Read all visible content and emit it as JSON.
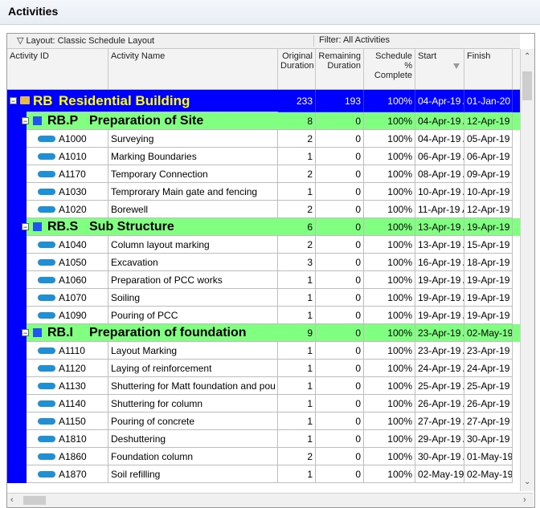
{
  "panel": {
    "title": "Activities"
  },
  "toolbar": {
    "layout_label": "Layout: Classic Schedule Layout",
    "filter_label": "Filter: All Activities"
  },
  "columns": [
    {
      "key": "id",
      "label": "Activity ID"
    },
    {
      "key": "name",
      "label": "Activity Name"
    },
    {
      "key": "orig",
      "label": "Original Duration"
    },
    {
      "key": "rem",
      "label": "Remaining Duration"
    },
    {
      "key": "pct",
      "label": "Schedule % Complete"
    },
    {
      "key": "start",
      "label": "Start"
    },
    {
      "key": "finish",
      "label": "Finish"
    }
  ],
  "colors": {
    "project_bg": "#0000ff",
    "project_text": "#ffff00",
    "wbs_bg": "#80ff80",
    "activity_bar": "#1f8fd6",
    "folder_icon": "#e7b94a",
    "wbs_icon": "#2255ee"
  },
  "rows": [
    {
      "type": "project",
      "id": "RB",
      "name": "Residential Building",
      "orig": "233",
      "rem": "193",
      "pct": "100%",
      "start": "04-Apr-19 A",
      "finish": "01-Jan-20"
    },
    {
      "type": "wbs",
      "id": "RB.P",
      "name": "Preparation of Site",
      "orig": "8",
      "rem": "0",
      "pct": "100%",
      "start": "04-Apr-19 A",
      "finish": "12-Apr-19 A"
    },
    {
      "type": "activity",
      "id": "A1000",
      "name": "Surveying",
      "orig": "2",
      "rem": "0",
      "pct": "100%",
      "start": "04-Apr-19 A",
      "finish": "05-Apr-19 A"
    },
    {
      "type": "activity",
      "id": "A1010",
      "name": "Marking Boundaries",
      "orig": "1",
      "rem": "0",
      "pct": "100%",
      "start": "06-Apr-19 A",
      "finish": "06-Apr-19 A"
    },
    {
      "type": "activity",
      "id": "A1170",
      "name": "Temporary Connection",
      "orig": "2",
      "rem": "0",
      "pct": "100%",
      "start": "08-Apr-19 A",
      "finish": "09-Apr-19 A"
    },
    {
      "type": "activity",
      "id": "A1030",
      "name": "Temprorary Main gate and fencing",
      "orig": "1",
      "rem": "0",
      "pct": "100%",
      "start": "10-Apr-19 A",
      "finish": "10-Apr-19 A"
    },
    {
      "type": "activity",
      "id": "A1020",
      "name": "Borewell",
      "orig": "2",
      "rem": "0",
      "pct": "100%",
      "start": "11-Apr-19 A",
      "finish": "12-Apr-19 A"
    },
    {
      "type": "wbs",
      "id": "RB.S",
      "name": "Sub Structure",
      "orig": "6",
      "rem": "0",
      "pct": "100%",
      "start": "13-Apr-19 A",
      "finish": "19-Apr-19 A"
    },
    {
      "type": "activity",
      "id": "A1040",
      "name": "Column layout marking",
      "orig": "2",
      "rem": "0",
      "pct": "100%",
      "start": "13-Apr-19 A",
      "finish": "15-Apr-19 A"
    },
    {
      "type": "activity",
      "id": "A1050",
      "name": "Excavation",
      "orig": "3",
      "rem": "0",
      "pct": "100%",
      "start": "16-Apr-19 A",
      "finish": "18-Apr-19 A"
    },
    {
      "type": "activity",
      "id": "A1060",
      "name": "Preparation of PCC works",
      "orig": "1",
      "rem": "0",
      "pct": "100%",
      "start": "19-Apr-19 A",
      "finish": "19-Apr-19 A"
    },
    {
      "type": "activity",
      "id": "A1070",
      "name": "Soiling",
      "orig": "1",
      "rem": "0",
      "pct": "100%",
      "start": "19-Apr-19 A",
      "finish": "19-Apr-19 A"
    },
    {
      "type": "activity",
      "id": "A1090",
      "name": "Pouring of PCC",
      "orig": "1",
      "rem": "0",
      "pct": "100%",
      "start": "19-Apr-19 A",
      "finish": "19-Apr-19 A"
    },
    {
      "type": "wbs",
      "id": "RB.I",
      "name": "Preparation of foundation",
      "orig": "9",
      "rem": "0",
      "pct": "100%",
      "start": "23-Apr-19 A",
      "finish": "02-May-19"
    },
    {
      "type": "activity",
      "id": "A1110",
      "name": "Layout Marking",
      "orig": "1",
      "rem": "0",
      "pct": "100%",
      "start": "23-Apr-19 A",
      "finish": "23-Apr-19 A"
    },
    {
      "type": "activity",
      "id": "A1120",
      "name": "Laying of reinforcement",
      "orig": "1",
      "rem": "0",
      "pct": "100%",
      "start": "24-Apr-19 A",
      "finish": "24-Apr-19 A"
    },
    {
      "type": "activity",
      "id": "A1130",
      "name": "Shuttering for Matt foundation and pou",
      "orig": "1",
      "rem": "0",
      "pct": "100%",
      "start": "25-Apr-19 A",
      "finish": "25-Apr-19 A"
    },
    {
      "type": "activity",
      "id": "A1140",
      "name": "Shuttering for column",
      "orig": "1",
      "rem": "0",
      "pct": "100%",
      "start": "26-Apr-19 A",
      "finish": "26-Apr-19 A"
    },
    {
      "type": "activity",
      "id": "A1150",
      "name": "Pouring of concrete",
      "orig": "1",
      "rem": "0",
      "pct": "100%",
      "start": "27-Apr-19 A",
      "finish": "27-Apr-19 A"
    },
    {
      "type": "activity",
      "id": "A1810",
      "name": "Deshuttering",
      "orig": "1",
      "rem": "0",
      "pct": "100%",
      "start": "29-Apr-19 A",
      "finish": "30-Apr-19 A"
    },
    {
      "type": "activity",
      "id": "A1860",
      "name": "Foundation column",
      "orig": "2",
      "rem": "0",
      "pct": "100%",
      "start": "30-Apr-19 A",
      "finish": "01-May-19"
    },
    {
      "type": "activity",
      "id": "A1870",
      "name": "Soil refilling",
      "orig": "1",
      "rem": "0",
      "pct": "100%",
      "start": "02-May-19",
      "finish": "02-May-19"
    }
  ]
}
